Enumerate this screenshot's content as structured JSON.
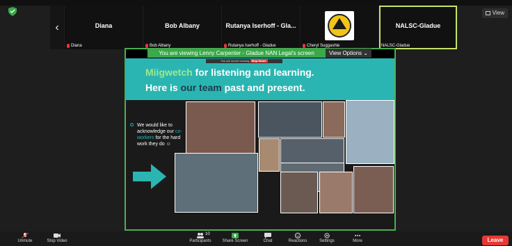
{
  "window": {
    "view_label": "View"
  },
  "strip": {
    "tiles": [
      {
        "name": "Diana",
        "label": "Diana"
      },
      {
        "name": "Bob Albany",
        "label": "Bob Albany"
      },
      {
        "name": "Rutanya Iserhoff - Gla...",
        "label": "Rutanya Iserhoff - Gladue"
      },
      {
        "name": "",
        "label": "Cheryl Suggashie"
      },
      {
        "name": "NALSC-Gladue",
        "label": "NALSC-Gladue"
      }
    ]
  },
  "share": {
    "banner": "You are viewing Lenny Carpenter - Gladue NAN Legal's screen",
    "view_options": "View Options",
    "stop_text": "You are screen sharing",
    "stop_button": "Stop Share"
  },
  "slide": {
    "line1_highlight": "Miigwetch",
    "line1_rest": " for listening and learning.",
    "line2_start": "Here is ",
    "line2_highlight": "our team",
    "line2_end": " past and present.",
    "ack_start": "We would like to acknowledge our ",
    "ack_highlight": "co-workers",
    "ack_end": " for the hard work they do ☺"
  },
  "toolbar": {
    "participants_count": "10",
    "items": [
      "Unmute",
      "Stop Video",
      "Participants",
      "Share Screen",
      "Chat",
      "Reactions",
      "Settings",
      "More"
    ],
    "leave": "Leave"
  },
  "colors": {
    "share_border": "#4caf50",
    "slide_teal": "#2bb5b2",
    "highlight_green": "#9fe98c",
    "leave_red": "#e53935",
    "active_tile": "#c8e46a"
  }
}
